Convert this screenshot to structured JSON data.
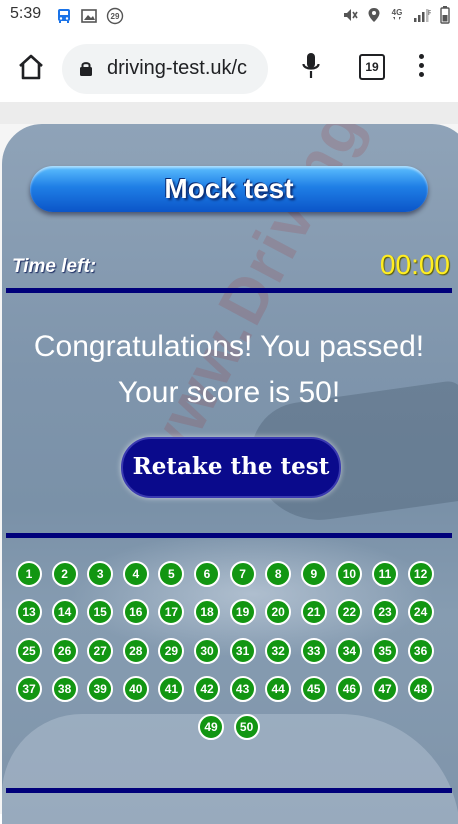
{
  "status_bar": {
    "time": "5:39",
    "right_icons": [
      "mute-icon",
      "location-icon",
      "4g-icon",
      "signal-icon",
      "battery-icon"
    ],
    "left_icons": [
      "bus-icon",
      "image-icon",
      "notification-29-icon"
    ],
    "notif_count": "29",
    "network": "4G",
    "signal_letter": "R"
  },
  "browser": {
    "url": "driving-test.uk/c",
    "tab_count": "19"
  },
  "page": {
    "title": "Mock test",
    "time_label": "Time left:",
    "time_value": "00:00",
    "result_line1": "Congratulations! You passed!",
    "result_line2": "Your score is 50!",
    "retake_label": "Retake the test",
    "watermark": "www.DrivingTest.UK",
    "question_color": "#129612",
    "accent_color": "#00007a",
    "questions": [
      "1",
      "2",
      "3",
      "4",
      "5",
      "6",
      "7",
      "8",
      "9",
      "10",
      "11",
      "12",
      "13",
      "14",
      "15",
      "16",
      "17",
      "18",
      "19",
      "20",
      "21",
      "22",
      "23",
      "24",
      "25",
      "26",
      "27",
      "28",
      "29",
      "30",
      "31",
      "32",
      "33",
      "34",
      "35",
      "36",
      "37",
      "38",
      "39",
      "40",
      "41",
      "42",
      "43",
      "44",
      "45",
      "46",
      "47",
      "48",
      "49",
      "50"
    ]
  }
}
